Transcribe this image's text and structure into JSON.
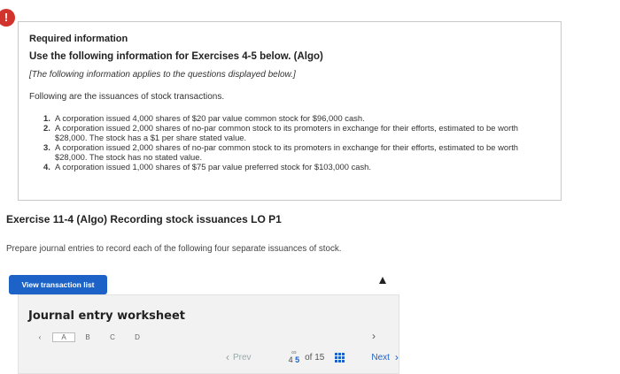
{
  "alert": {
    "glyph": "!"
  },
  "info": {
    "title": "Required information",
    "subtitle": "Use the following information for Exercises 4-5 below. (Algo)",
    "note": "[The following information applies to the questions displayed below.]",
    "intro": "Following are the issuances of stock transactions.",
    "transactions": [
      {
        "num": "1.",
        "text": "A corporation issued 4,000 shares of $20 par value common stock for $96,000 cash."
      },
      {
        "num": "2.",
        "text": "A corporation issued 2,000 shares of no-par common stock to its promoters in exchange for their efforts, estimated to be worth $28,000. The stock has a $1 per share stated value."
      },
      {
        "num": "3.",
        "text": "A corporation issued 2,000 shares of no-par common stock to its promoters in exchange for their efforts, estimated to be worth $28,000. The stock has no stated value."
      },
      {
        "num": "4.",
        "text": "A corporation issued 1,000 shares of $75 par value preferred stock for $103,000 cash."
      }
    ]
  },
  "exercise": {
    "title": "Exercise 11-4 (Algo) Recording stock issuances LO P1",
    "instruction": "Prepare journal entries to record each of the following four separate issuances of stock."
  },
  "buttons": {
    "view_transaction_list": "View transaction list"
  },
  "worksheet": {
    "title": "Journal entry worksheet",
    "tabs": [
      "A",
      "B",
      "C",
      "D"
    ],
    "nav_left": "‹",
    "nav_right": "›"
  },
  "pagination": {
    "prev_label": "Prev",
    "pages": [
      "4",
      "5"
    ],
    "current_page": "5",
    "of_label": "of 15",
    "next_label": "Next"
  }
}
